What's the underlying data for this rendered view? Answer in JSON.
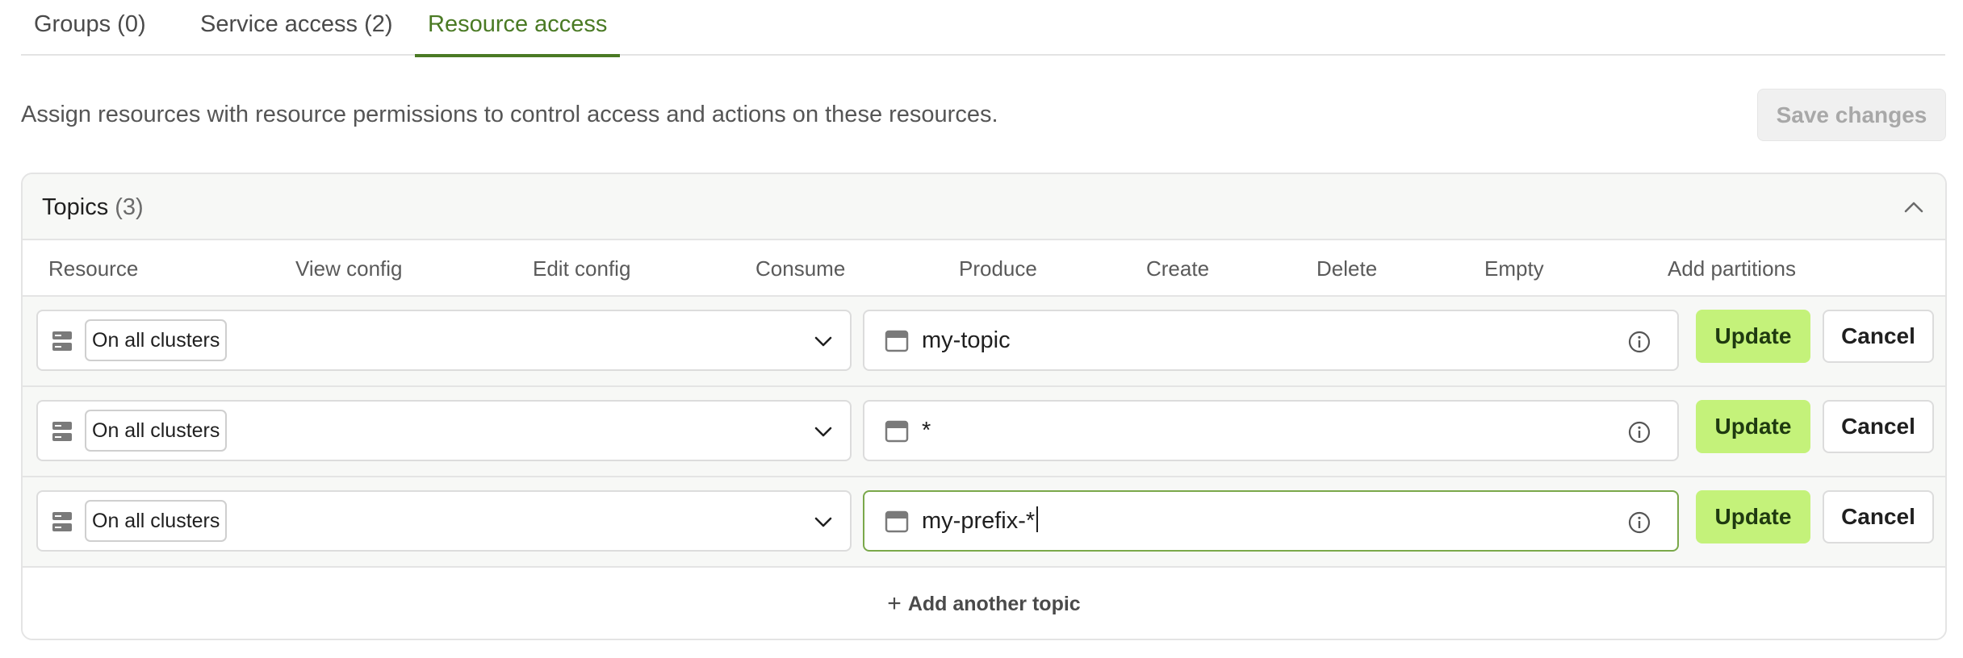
{
  "tabs": [
    {
      "label": "Groups (0)"
    },
    {
      "label": "Service access (2)"
    },
    {
      "label": "Resource access",
      "active": true
    }
  ],
  "description": "Assign resources with resource permissions to control access and actions on these resources.",
  "save_button": {
    "label": "Save changes",
    "disabled": true
  },
  "topics_panel": {
    "title": "Topics",
    "count": "(3)",
    "columns": [
      "Resource",
      "View config",
      "Edit config",
      "Consume",
      "Produce",
      "Create",
      "Delete",
      "Empty",
      "Add partitions"
    ],
    "rows": [
      {
        "cluster_scope": "On all clusters",
        "topic_value": "my-topic",
        "update_label": "Update",
        "cancel_label": "Cancel"
      },
      {
        "cluster_scope": "On all clusters",
        "topic_value": "*",
        "update_label": "Update",
        "cancel_label": "Cancel"
      },
      {
        "cluster_scope": "On all clusters",
        "topic_value": "my-prefix-*",
        "update_label": "Update",
        "cancel_label": "Cancel"
      }
    ],
    "add_another_label": "Add another topic"
  },
  "colors": {
    "accent": "#4a7a24",
    "update_button": "#c4f27a",
    "focus_border": "#7aa84a",
    "disabled_text": "#a8a8a8"
  },
  "icons": {
    "server": "server-icon",
    "topic": "topic-icon",
    "info": "info-icon",
    "chevron_down": "chevron-down-icon",
    "chevron_up": "chevron-up-icon",
    "plus": "plus-icon"
  }
}
